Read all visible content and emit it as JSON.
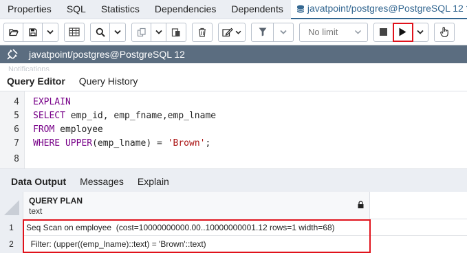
{
  "top_tabs": [
    "Properties",
    "SQL",
    "Statistics",
    "Dependencies",
    "Dependents"
  ],
  "active_tab": "javatpoint/postgres@PostgreSQL 12 *",
  "toolbar": {
    "limit_label": "No limit"
  },
  "connection": "javatpoint/postgres@PostgreSQL 12",
  "notifications_label": "Notifications",
  "query_tabs": [
    "Query Editor",
    "Query History"
  ],
  "editor_lines": [
    {
      "num": "4",
      "tokens": [
        {
          "t": "EXPLAIN",
          "c": "kw"
        }
      ]
    },
    {
      "num": "5",
      "tokens": [
        {
          "t": "SELECT",
          "c": "kw"
        },
        {
          "t": " emp_id, emp_fname,emp_lname",
          "c": ""
        }
      ]
    },
    {
      "num": "6",
      "tokens": [
        {
          "t": "FROM",
          "c": "kw"
        },
        {
          "t": " employee",
          "c": ""
        }
      ]
    },
    {
      "num": "7",
      "tokens": [
        {
          "t": "WHERE",
          "c": "kw"
        },
        {
          "t": " ",
          "c": ""
        },
        {
          "t": "UPPER",
          "c": "kw"
        },
        {
          "t": "(emp_lname) = ",
          "c": ""
        },
        {
          "t": "'Brown'",
          "c": "str"
        },
        {
          "t": ";",
          "c": ""
        }
      ]
    },
    {
      "num": "8",
      "tokens": []
    }
  ],
  "result_tabs": [
    "Data Output",
    "Messages",
    "Explain"
  ],
  "grid": {
    "column_name": "QUERY PLAN",
    "column_type": "text",
    "rows": [
      {
        "num": "1",
        "value": "Seq Scan on employee  (cost=10000000000.00..10000000001.12 rows=1 width=68)"
      },
      {
        "num": "2",
        "value": "  Filter: (upper((emp_lname)::text) = 'Brown'::text)"
      }
    ]
  },
  "colors": {
    "connection_bar": "#5b6d80",
    "highlight": "#e0121b",
    "keyword": "#770088",
    "string": "#aa1111",
    "active_tab": "#326690"
  }
}
